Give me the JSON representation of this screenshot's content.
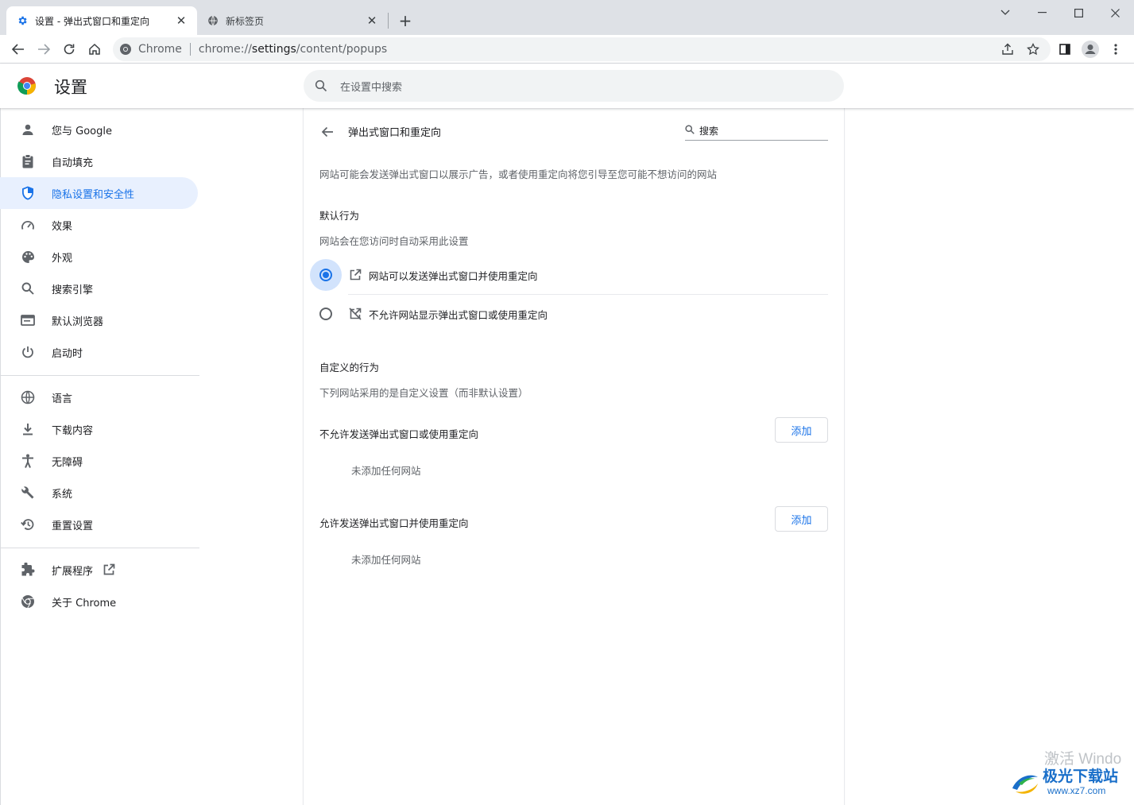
{
  "tabs": [
    {
      "title": "设置 - 弹出式窗口和重定向",
      "active": true
    },
    {
      "title": "新标签页",
      "active": false
    }
  ],
  "omnibox": {
    "chip": "Chrome",
    "url_prefix": "chrome://",
    "url_host": "settings",
    "url_path": "/content/popups"
  },
  "header": {
    "title": "设置",
    "search_placeholder": "在设置中搜索"
  },
  "sidebar": {
    "items": [
      {
        "label": "您与 Google",
        "icon": "person-icon"
      },
      {
        "label": "自动填充",
        "icon": "clipboard-icon"
      },
      {
        "label": "隐私设置和安全性",
        "icon": "shield-icon"
      },
      {
        "label": "效果",
        "icon": "gauge-icon"
      },
      {
        "label": "外观",
        "icon": "palette-icon"
      },
      {
        "label": "搜索引擎",
        "icon": "search-icon"
      },
      {
        "label": "默认浏览器",
        "icon": "browser-icon"
      },
      {
        "label": "启动时",
        "icon": "power-icon"
      },
      {
        "label": "语言",
        "icon": "globe-icon"
      },
      {
        "label": "下载内容",
        "icon": "download-icon"
      },
      {
        "label": "无障碍",
        "icon": "accessibility-icon"
      },
      {
        "label": "系统",
        "icon": "wrench-icon"
      },
      {
        "label": "重置设置",
        "icon": "reset-icon"
      },
      {
        "label": "扩展程序",
        "icon": "puzzle-icon"
      },
      {
        "label": "关于 Chrome",
        "icon": "chrome-icon"
      }
    ],
    "selected_index": 2
  },
  "main": {
    "title": "弹出式窗口和重定向",
    "search_label": "搜索",
    "description": "网站可能会发送弹出式窗口以展示广告，或者使用重定向将您引导至您可能不想访问的网站",
    "default_heading": "默认行为",
    "default_sub": "网站会在您访问时自动采用此设置",
    "options": [
      {
        "label": "网站可以发送弹出式窗口并使用重定向",
        "checked": true
      },
      {
        "label": "不允许网站显示弹出式窗口或使用重定向",
        "checked": false
      }
    ],
    "custom_heading": "自定义的行为",
    "custom_sub": "下列网站采用的是自定义设置（而非默认设置）",
    "block_section": {
      "label": "不允许发送弹出式窗口或使用重定向",
      "add_label": "添加",
      "empty": "未添加任何网站"
    },
    "allow_section": {
      "label": "允许发送弹出式窗口并使用重定向",
      "add_label": "添加",
      "empty": "未添加任何网站"
    }
  },
  "watermark": {
    "activate": "激活 Windo",
    "site": "极光下载站",
    "url": "www.xz7.com"
  },
  "colors": {
    "accent": "#1a73e8",
    "selected_bg": "#e8f0fe",
    "tabstrip": "#dee1e6"
  }
}
